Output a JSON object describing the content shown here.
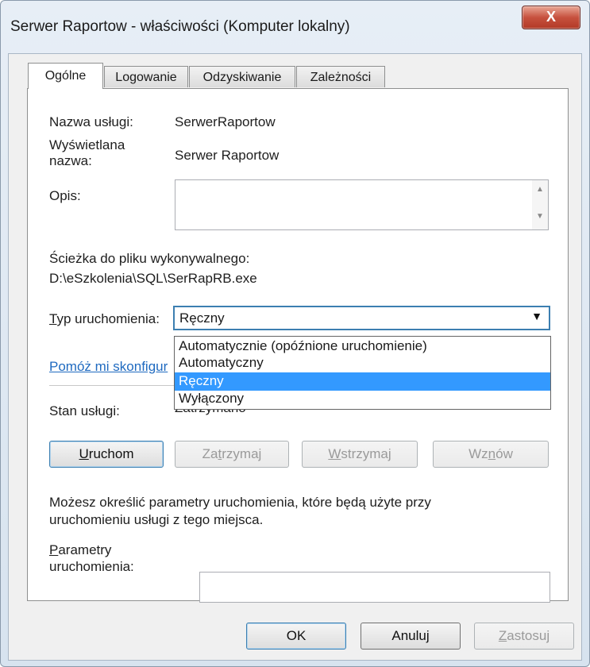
{
  "window": {
    "title": "Serwer Raportow - właściwości (Komputer lokalny)",
    "close_glyph": "X"
  },
  "tabs": [
    {
      "label": "Ogólne",
      "active": true
    },
    {
      "label": "Logowanie",
      "active": false
    },
    {
      "label": "Odzyskiwanie",
      "active": false
    },
    {
      "label": "Zależności",
      "active": false
    }
  ],
  "general": {
    "service_name_label": "Nazwa usługi:",
    "service_name_value": "SerwerRaportow",
    "display_name_label_line1": "Wyświetlana",
    "display_name_label_line2": "nazwa:",
    "display_name_value": "Serwer Raportow",
    "description_label": "Opis:",
    "description_value": "",
    "path_label": "Ścieżka do pliku wykonywalnego:",
    "path_value": "D:\\eSzkolenia\\SQL\\SerRapRB.exe",
    "startup_type_label_prefix": "T",
    "startup_type_label_rest": "yp uruchomienia:",
    "startup_type_value": "Ręczny",
    "startup_options": [
      "Automatycznie (opóźnione uruchomienie)",
      "Automatyczny",
      "Ręczny",
      "Wyłączony"
    ],
    "startup_selected_index": 2,
    "help_link": "Pomóż mi skonfigur",
    "status_label": "Stan usługi:",
    "status_value": "Zatrzymano",
    "buttons": {
      "start": {
        "u": "U",
        "rest": "ruchom"
      },
      "stop": {
        "pre": "Za",
        "u": "t",
        "rest": "rzymaj"
      },
      "pause": {
        "u": "W",
        "rest": "strzymaj"
      },
      "resume": {
        "pre": "Wz",
        "u": "n",
        "rest": "ów"
      }
    },
    "params_note_line1": "Możesz określić parametry uruchomienia, które będą użyte przy",
    "params_note_line2": "uruchomieniu usługi z tego miejsca.",
    "params_label_u": "P",
    "params_label_line1_rest": "arametry",
    "params_label_line2": "uruchomienia:",
    "params_value": ""
  },
  "footer": {
    "ok": "OK",
    "cancel": "Anuluj",
    "apply_u": "Z",
    "apply_rest": "astosuj"
  }
}
